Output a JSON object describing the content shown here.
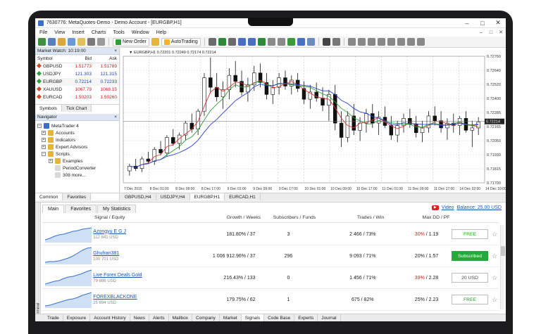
{
  "window": {
    "title": "7630776: MetaQuotes-Demo - Demo Account - [EURGBP,H1]",
    "controls": [
      "–",
      "□",
      "✕"
    ]
  },
  "menu": {
    "items": [
      "File",
      "View",
      "Insert",
      "Charts",
      "Tools",
      "Window",
      "Help"
    ],
    "mdi_controls": [
      "–",
      "□",
      "✕"
    ]
  },
  "toolbar": {
    "new_order_label": "New Order",
    "autotrading_label": "AutoTrading"
  },
  "market_watch": {
    "header": "Market Watch: 10:19:00",
    "columns": [
      "Symbol",
      "Bid",
      "Ask"
    ],
    "rows": [
      {
        "symbol": "GBPUSD",
        "bid": "1.51773",
        "ask": "1.51789"
      },
      {
        "symbol": "USDJPY",
        "bid": "121.303",
        "ask": "121.315"
      },
      {
        "symbol": "EURGBP",
        "bid": "0.72214",
        "ask": "0.72233"
      },
      {
        "symbol": "XAUUSD",
        "bid": "1067.79",
        "ask": "1068.15"
      },
      {
        "symbol": "EURCAD",
        "bid": "1.50203",
        "ask": "1.50260"
      }
    ],
    "tabs": [
      "Symbols",
      "Tick Chart"
    ]
  },
  "navigator": {
    "header": "Navigator",
    "root": "MetaTrader 4",
    "items": [
      "Accounts",
      "Indicators",
      "Expert Advisors",
      "Scripts"
    ],
    "scripts": [
      "Examples",
      "PeriodConverter",
      "308 more..."
    ],
    "tabs": [
      "Common",
      "Favorites"
    ]
  },
  "chart": {
    "info": "EURGBP,H1  0.72201 0.72249 0.72174 0.72214",
    "tabs": [
      "GBPUSD,H4",
      "USDJPY,H4",
      "EURGBP,H1",
      "EURCAD,H1"
    ]
  },
  "chart_data": {
    "type": "candlestick",
    "symbol": "EURGBP",
    "timeframe": "H1",
    "y_ticks": [
      "0.72760",
      "0.72640",
      "0.72520",
      "0.72400",
      "0.72285",
      "0.72165",
      "0.72050",
      "0.71930",
      "0.71815",
      "0.71700"
    ],
    "ylim": [
      0.717,
      0.7276
    ],
    "x_ticks": [
      "7 Dec 2015",
      "8 Dec 01:00",
      "8 Dec 09:00",
      "8 Dec 17:00",
      "9 Dec 01:00",
      "9 Dec 09:00",
      "9 Dec 17:00",
      "10 Dec 01:00",
      "10 Dec 09:00",
      "10 Dec 17:00",
      "11 Dec 01:00",
      "11 Dec 09:00",
      "11 Dec 17:00",
      "14 Dec 02:00",
      "14 Dec 10:00"
    ],
    "current_price": "0.72214",
    "candles": [
      [
        0.718,
        0.7186,
        0.7176,
        0.7184
      ],
      [
        0.7184,
        0.719,
        0.718,
        0.7182
      ],
      [
        0.7182,
        0.7192,
        0.7179,
        0.719
      ],
      [
        0.719,
        0.7196,
        0.7186,
        0.7188
      ],
      [
        0.7188,
        0.72,
        0.7185,
        0.7198
      ],
      [
        0.7198,
        0.7205,
        0.7193,
        0.7195
      ],
      [
        0.7195,
        0.721,
        0.7192,
        0.7208
      ],
      [
        0.7208,
        0.7215,
        0.7201,
        0.7203
      ],
      [
        0.7203,
        0.7212,
        0.7198,
        0.721
      ],
      [
        0.721,
        0.7222,
        0.7206,
        0.722
      ],
      [
        0.722,
        0.7228,
        0.7212,
        0.7215
      ],
      [
        0.7215,
        0.7232,
        0.721,
        0.723
      ],
      [
        0.723,
        0.7262,
        0.7226,
        0.7258
      ],
      [
        0.7258,
        0.7275,
        0.7245,
        0.725
      ],
      [
        0.725,
        0.7262,
        0.7238,
        0.7242
      ],
      [
        0.7242,
        0.7255,
        0.7232,
        0.7248
      ],
      [
        0.7248,
        0.7266,
        0.724,
        0.726
      ],
      [
        0.726,
        0.7272,
        0.725,
        0.7255
      ],
      [
        0.7255,
        0.7264,
        0.7243,
        0.7246
      ],
      [
        0.7246,
        0.7258,
        0.7238,
        0.7252
      ],
      [
        0.7252,
        0.7268,
        0.7247,
        0.7262
      ],
      [
        0.7262,
        0.727,
        0.725,
        0.7254
      ],
      [
        0.7254,
        0.7262,
        0.724,
        0.7244
      ],
      [
        0.7244,
        0.7256,
        0.7236,
        0.725
      ],
      [
        0.725,
        0.7262,
        0.7244,
        0.7258
      ],
      [
        0.7258,
        0.7264,
        0.7248,
        0.7251
      ],
      [
        0.7251,
        0.726,
        0.7244,
        0.7256
      ],
      [
        0.7256,
        0.7262,
        0.7246,
        0.7249
      ],
      [
        0.7249,
        0.7255,
        0.7236,
        0.724
      ],
      [
        0.724,
        0.7252,
        0.7232,
        0.7246
      ],
      [
        0.7246,
        0.7254,
        0.7238,
        0.7241
      ],
      [
        0.7241,
        0.725,
        0.723,
        0.7235
      ],
      [
        0.7235,
        0.7248,
        0.7222,
        0.7244
      ],
      [
        0.7244,
        0.7252,
        0.7214,
        0.722
      ],
      [
        0.722,
        0.723,
        0.72,
        0.7208
      ],
      [
        0.7208,
        0.723,
        0.7204,
        0.7226
      ],
      [
        0.7226,
        0.7236,
        0.721,
        0.7214
      ],
      [
        0.7214,
        0.7225,
        0.7205,
        0.722
      ],
      [
        0.722,
        0.7232,
        0.7212,
        0.7228
      ],
      [
        0.7228,
        0.7236,
        0.7216,
        0.722
      ],
      [
        0.722,
        0.723,
        0.721,
        0.7225
      ],
      [
        0.7225,
        0.7234,
        0.7216,
        0.7218
      ],
      [
        0.7218,
        0.7226,
        0.7206,
        0.721
      ],
      [
        0.721,
        0.7222,
        0.7204,
        0.7218
      ],
      [
        0.7218,
        0.7228,
        0.7212,
        0.7224
      ],
      [
        0.7224,
        0.7232,
        0.7216,
        0.7219
      ],
      [
        0.7219,
        0.7226,
        0.7208,
        0.7212
      ],
      [
        0.7212,
        0.7222,
        0.7204,
        0.7216
      ],
      [
        0.7216,
        0.723,
        0.7212,
        0.7226
      ],
      [
        0.7226,
        0.7234,
        0.7218,
        0.7222
      ],
      [
        0.7222,
        0.723,
        0.7212,
        0.7216
      ],
      [
        0.7216,
        0.7224,
        0.7206,
        0.722
      ],
      [
        0.722,
        0.7228,
        0.7212,
        0.7218
      ],
      [
        0.7218,
        0.7226,
        0.721,
        0.7224
      ],
      [
        0.7224,
        0.723,
        0.7212,
        0.7214
      ],
      [
        0.7214,
        0.7222,
        0.72,
        0.7216
      ],
      [
        0.7216,
        0.7225,
        0.721,
        0.7221
      ]
    ],
    "moving_averages": [
      {
        "color": "#e03030",
        "period": "fast"
      },
      {
        "color": "#2f9e3a",
        "period": "medium"
      },
      {
        "color": "#2a3fd0",
        "period": "slow"
      }
    ]
  },
  "signals": {
    "tabs": [
      "Main",
      "Favorites",
      "My Statistics"
    ],
    "video_label": "Video",
    "balance_label": "Balance: 25.00 USD",
    "columns": [
      "Signal / Equity",
      "Growth / Weeks",
      "Subscribers / Funds",
      "Trades / Win",
      "Max DD / PF"
    ],
    "rows": [
      {
        "name": "Azongyu E G J",
        "equity": "112 841 USD",
        "growth": "181.80% / 37",
        "subs": "3",
        "trades": "2 466 / 73%",
        "dd": "30%",
        "pf": " / 1.19",
        "dd_color": "#d32020",
        "button": "FREE",
        "state": "free"
      },
      {
        "name": "Ghufran381",
        "equity": "100 701 USD",
        "growth": "1 006 912.96% / 37",
        "subs": "296",
        "trades": "9 093 / 71%",
        "dd": "20%",
        "pf": " / 1.57",
        "dd_color": "#1a1a1a",
        "button": "Subscribed",
        "state": "subscribed"
      },
      {
        "name": "Live Forex Deals Gold",
        "equity": "79 886 USD",
        "growth": "216.43% / 133",
        "subs": "0",
        "trades": "1 456 / 71%",
        "dd": "39%",
        "pf": " / 2.28",
        "dd_color": "#d32020",
        "button": "20 USD",
        "state": "price"
      },
      {
        "name": "FOREXBLACKONE",
        "equity": "25 894 USD",
        "growth": "179.75% / 62",
        "subs": "1",
        "trades": "675 / 82%",
        "dd": "25%",
        "pf": " / 2.23",
        "dd_color": "#1a1a1a",
        "button": "FREE",
        "state": "free"
      }
    ]
  },
  "terminal": {
    "side_label": "Terminal",
    "tabs": [
      "Trade",
      "Exposure",
      "Account History",
      "News",
      "Alerts",
      "Mailbox",
      "Company",
      "Market",
      "Signals",
      "Code Base",
      "Experts",
      "Journal"
    ],
    "active_tab": "Signals"
  }
}
